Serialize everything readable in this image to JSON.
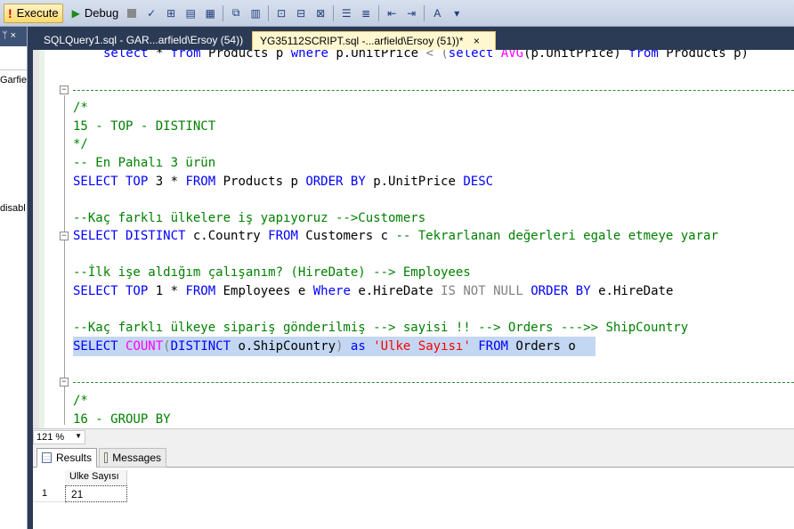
{
  "toolbar": {
    "execute_label": "Execute",
    "debug_label": "Debug"
  },
  "left_panel": {
    "text1": "Garfie",
    "text2": "disabl"
  },
  "tabs": [
    {
      "label": "SQLQuery1.sql - GAR...arfield\\Ersoy (54))",
      "active": false
    },
    {
      "label": "YG35112SCRIPT.sql -...arfield\\Ersoy (51))*",
      "active": true,
      "close": "×"
    }
  ],
  "editor": {
    "line_prev_kw1": "select",
    "line_prev_rest1": " * ",
    "line_prev_kw2": "from",
    "line_prev_rest2": " Products p ",
    "line_prev_kw3": "where",
    "line_prev_rest3": " p.UnitPrice ",
    "line_prev_op": "<",
    "line_prev_paren": " (",
    "line_prev_kw4": "select",
    "line_prev_fn": " AVG",
    "line_prev_rest4": "(p.UnitPrice) ",
    "line_prev_kw5": "from",
    "line_prev_rest5": " Products p)",
    "separator": "----------------------------------------------------------------------------------------------------------------------------------------------",
    "c1_open": "/*",
    "c1_title": "15 - TOP - DISTINCT",
    "c1_close": "*/",
    "c2": "-- En Pahalı 3 ürün",
    "q1": {
      "select": "SELECT",
      "top": " TOP",
      "n": " 3 * ",
      "from": "FROM",
      "tbl": " Products p ",
      "order": "ORDER BY",
      "col": " p.UnitPrice ",
      "desc": "DESC"
    },
    "c3": "--Kaç farklı ülkelere iş yapıyoruz -->Customers",
    "q2": {
      "select": "SELECT",
      "distinct": " DISTINCT",
      "col": " c.Country ",
      "from": "FROM",
      "tbl": " Customers c ",
      "comment": "-- Tekrarlanan değerleri egale etmeye yarar"
    },
    "c4": "--İlk işe aldığım çalışanım? (HireDate) --> Employees",
    "q3": {
      "select": "SELECT",
      "top": " TOP",
      "n": " 1 * ",
      "from": "FROM",
      "tbl": " Employees e ",
      "where": "Where",
      "col": " e.HireDate ",
      "isnot": "IS NOT NULL",
      "sp": " ",
      "order": "ORDER BY",
      "col2": " e.HireDate"
    },
    "c5": "--Kaç farklı ülkeye sipariş gönderilmiş --> sayisi !! --> Orders --->> ShipCountry",
    "q4": {
      "select": "SELECT",
      "sp": " ",
      "count": "COUNT",
      "paren": "(",
      "distinct": "DISTINCT",
      "col": " o.ShipCountry",
      "paren2": ")",
      "as": " as ",
      "alias": "'Ulke Sayısı'",
      "from": " FROM",
      "tbl": " Orders o"
    },
    "c6_open": "/*",
    "c6_title": "16 - GROUP BY"
  },
  "zoom": {
    "value": "121 %"
  },
  "results": {
    "tab_results": "Results",
    "tab_messages": "Messages",
    "columns": [
      "Ulke Sayısı"
    ],
    "rows": [
      {
        "num": "1",
        "values": [
          "21"
        ]
      }
    ]
  }
}
